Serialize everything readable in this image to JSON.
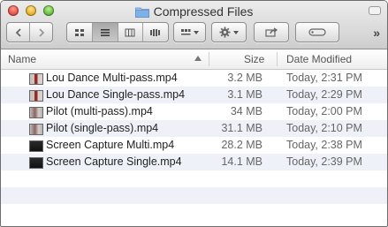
{
  "window": {
    "title": "Compressed Files"
  },
  "columns": {
    "name": "Name",
    "size": "Size",
    "date": "Date Modified"
  },
  "files": [
    {
      "name": "Lou Dance Multi-pass.mp4",
      "size": "3.2 MB",
      "date": "Today, 2:31 PM",
      "thumb": "dance"
    },
    {
      "name": "Lou Dance Single-pass.mp4",
      "size": "3.1 MB",
      "date": "Today, 2:29 PM",
      "thumb": "dance"
    },
    {
      "name": "Pilot (multi-pass).mp4",
      "size": "34 MB",
      "date": "Today, 2:00 PM",
      "thumb": "pilot"
    },
    {
      "name": "Pilot (single-pass).mp4",
      "size": "31.1 MB",
      "date": "Today, 2:10 PM",
      "thumb": "pilot"
    },
    {
      "name": "Screen Capture Multi.mp4",
      "size": "28.2 MB",
      "date": "Today, 2:38 PM",
      "thumb": "screen"
    },
    {
      "name": "Screen Capture Single.mp4",
      "size": "14.1 MB",
      "date": "Today, 2:39 PM",
      "thumb": "screen"
    }
  ],
  "empty_rows": 3,
  "colors": {
    "row_stripe": "#eef2f8",
    "folder": "#7fb0e6"
  }
}
